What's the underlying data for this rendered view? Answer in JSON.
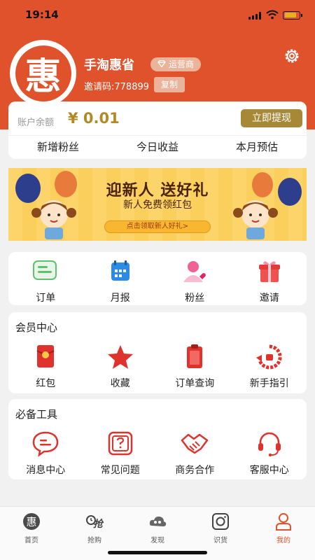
{
  "status": {
    "time": "19:14"
  },
  "profile": {
    "avatar_char": "惠",
    "username": "手淘惠省",
    "role": "运营商",
    "invite_text": "邀请码:778899",
    "copy_label": "复制"
  },
  "balance": {
    "label": "账户余额",
    "value": "¥ 0.01",
    "withdraw_label": "立即提现",
    "stats": [
      "新增粉丝",
      "今日收益",
      "本月预估"
    ]
  },
  "banner": {
    "title": "迎新人 送好礼",
    "subtitle": "新人免费领红包",
    "cta": "点击领取新人好礼>"
  },
  "quick_actions": [
    {
      "label": "订单",
      "icon": "order-icon"
    },
    {
      "label": "月报",
      "icon": "monthly-report-icon"
    },
    {
      "label": "粉丝",
      "icon": "fans-icon"
    },
    {
      "label": "邀请",
      "icon": "invite-gift-icon"
    }
  ],
  "member_center": {
    "title": "会员中心",
    "items": [
      {
        "label": "红包",
        "icon": "red-envelope-icon"
      },
      {
        "label": "收藏",
        "icon": "star-icon"
      },
      {
        "label": "订单查询",
        "icon": "clipboard-icon"
      },
      {
        "label": "新手指引",
        "icon": "guide-icon"
      }
    ]
  },
  "tools": {
    "title": "必备工具",
    "items": [
      {
        "label": "消息中心",
        "icon": "message-icon"
      },
      {
        "label": "常见问题",
        "icon": "question-icon"
      },
      {
        "label": "商务合作",
        "icon": "handshake-icon"
      },
      {
        "label": "客服中心",
        "icon": "headset-icon"
      }
    ]
  },
  "tabbar": [
    {
      "label": "首页",
      "icon": "home-hui-icon",
      "active": false
    },
    {
      "label": "抢购",
      "icon": "flash-sale-icon",
      "active": false
    },
    {
      "label": "发现",
      "icon": "discover-cloud-icon",
      "active": false
    },
    {
      "label": "识货",
      "icon": "camera-icon",
      "active": false
    },
    {
      "label": "我的",
      "icon": "profile-icon",
      "active": true
    }
  ],
  "colors": {
    "brand": "#e0522c",
    "gold": "#a78836",
    "accent_red": "#e0322c"
  }
}
